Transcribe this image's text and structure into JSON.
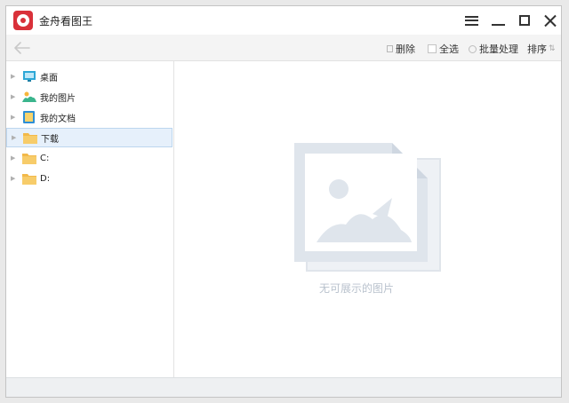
{
  "app": {
    "title": "金舟看图王"
  },
  "toolbar": {
    "delete_label": "删除",
    "select_all_label": "全选",
    "batch_label": "批量处理",
    "sort_label": "排序"
  },
  "sidebar": {
    "items": [
      {
        "label": "桌面",
        "icon": "desktop-icon"
      },
      {
        "label": "我的图片",
        "icon": "pictures-icon"
      },
      {
        "label": "我的文档",
        "icon": "documents-icon"
      },
      {
        "label": "下载",
        "icon": "folder-icon",
        "selected": true
      },
      {
        "label": "C:",
        "icon": "folder-icon"
      },
      {
        "label": "D:",
        "icon": "folder-icon"
      }
    ]
  },
  "main": {
    "empty_text": "无可展示的图片"
  },
  "colors": {
    "brand": "#d9313a",
    "selection": "#e6f0fb",
    "placeholder": "#dfe5ec"
  }
}
